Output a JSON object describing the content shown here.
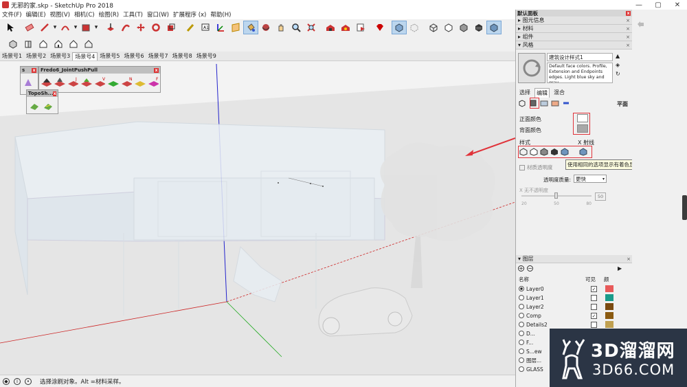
{
  "window": {
    "title": "无邪的家.skp - SketchUp Pro 2018"
  },
  "menu": [
    "文件(F)",
    "编辑(E)",
    "视图(V)",
    "相机(C)",
    "绘图(R)",
    "工具(T)",
    "窗口(W)",
    "扩展程序 (x)",
    "帮助(H)"
  ],
  "toolbar1": [
    "select-icon",
    "eraser-icon",
    "pencil-icon",
    "dropdown-arrow-icon",
    "arc-icon",
    "dropdown-arrow-icon",
    "push-pull-icon",
    "dropdown-arrow-icon",
    "push-pull-red-icon",
    "follow-me-icon",
    "move-icon",
    "rotate-icon",
    "scale-icon",
    "tape-measure-icon",
    "text-icon",
    "paint-bucket-icon",
    "orbit-icon",
    "pan-icon",
    "zoom-icon",
    "zoom-extents-icon",
    "warehouse-icon",
    "extension-warehouse-icon",
    "send-to-layout-icon",
    "ruby-icon",
    "xray-icon",
    "back-edges-icon",
    "wireframe-icon",
    "hidden-line-icon",
    "shaded-icon",
    "shaded-textures-icon",
    "monochrome-icon"
  ],
  "toolbar2": [
    "iso-view-icon",
    "top-view-icon",
    "front-view-icon",
    "right-view-icon",
    "back-view-icon",
    "left-view-icon"
  ],
  "scenes": [
    "场景号1",
    "场景号2",
    "场景号3",
    "场景号4",
    "场景号5",
    "场景号6",
    "场景号7",
    "场景号8",
    "场景号9"
  ],
  "active_scene": "场景号4",
  "float_panels": {
    "fredo": {
      "title": "Fredo6_JointPushPull",
      "letters": [
        "J",
        "V",
        "N",
        "F"
      ]
    },
    "s": {
      "title": "s"
    },
    "topo": {
      "title": "TopoSh..."
    }
  },
  "status": {
    "text": "选择涂刷对象。Alt =材料采样。"
  },
  "tray": {
    "title": "默认面板",
    "sections": [
      "图元信息",
      "材料",
      "组件",
      "风格"
    ],
    "style": {
      "name": "建筑设计样式1",
      "description": "Default face colors. Profile, Extension and Endpoints edges. Light blue sky and gray",
      "tabs": [
        "选择",
        "编辑",
        "混合"
      ],
      "plane_label": "平面",
      "front_color_label": "正面颜色",
      "back_color_label": "背面颜色",
      "style_label": "样式",
      "xray_label": "X 射线",
      "material_transparency_label": "材质透明度",
      "transparency_quality_label": "透明度质量:",
      "transparency_quality_value": "更快",
      "no_transparency_label": "X 无不透明度",
      "slider_ticks": [
        "20",
        "50",
        "80"
      ],
      "slider_value": "50",
      "tooltip": "使用相同的选项显示有着色显示的内容。"
    },
    "layers": {
      "title": "图层",
      "col_name": "名称",
      "col_visible": "可见",
      "col_color": "颜",
      "rows": [
        {
          "name": "Layer0",
          "active": true,
          "visible": true,
          "color": "#e85a5a"
        },
        {
          "name": "Layer1",
          "active": false,
          "visible": false,
          "color": "#1a9b8a"
        },
        {
          "name": "Layer2",
          "active": false,
          "visible": false,
          "color": "#7a4a10"
        },
        {
          "name": "Comp",
          "active": false,
          "visible": true,
          "color": "#8a5a10"
        },
        {
          "name": "Details2",
          "active": false,
          "visible": false,
          "color": "#c0a050"
        },
        {
          "name": "D...",
          "active": false,
          "visible": false,
          "color": "#555"
        },
        {
          "name": "F...",
          "active": false,
          "visible": false,
          "color": "#777"
        },
        {
          "name": "S...ew",
          "active": false,
          "visible": false,
          "color": "#999"
        },
        {
          "name": "图层...",
          "active": false,
          "visible": false,
          "color": "#aaa"
        },
        {
          "name": "GLASS",
          "active": false,
          "visible": false,
          "color": "#bbb"
        }
      ]
    }
  },
  "watermark": {
    "brand": "3D溜溜网",
    "url": "3D66.COM"
  },
  "colors": {
    "accent_red": "#e0333a",
    "selection_blue": "#bcd6ee"
  }
}
